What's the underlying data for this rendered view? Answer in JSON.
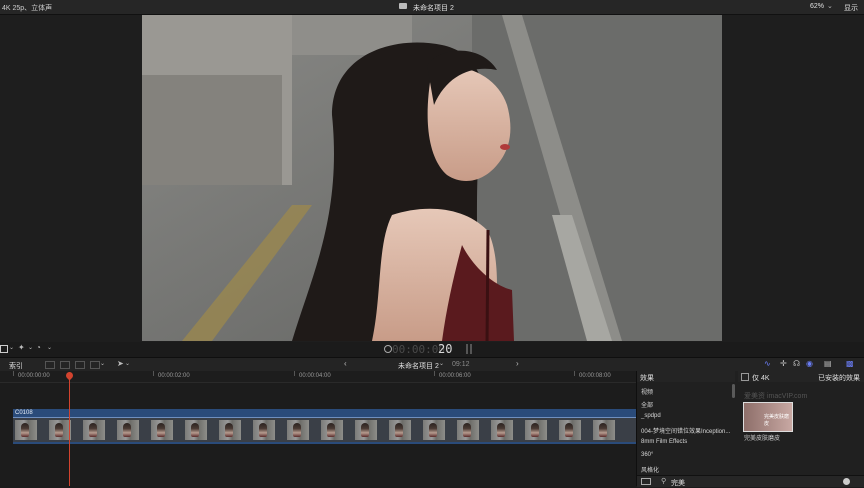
{
  "topbar": {
    "format": "4K 25p、立体声",
    "project_title": "未命名项目 2",
    "zoom": "62%",
    "view_label": "显示"
  },
  "viewer": {
    "timecode_dim": "00:00:00:",
    "timecode_frames": "20"
  },
  "toolbar": {
    "index_label": "索引",
    "project_title": "未命名项目 2",
    "duration": "09:12",
    "only_4k": "仅 4K",
    "installed_effects": "已安装的效果"
  },
  "ruler": {
    "labels": [
      "00:00:00:00",
      "00:00:02:00",
      "00:00:04:00",
      "00:00:06:00",
      "00:00:08:00"
    ]
  },
  "clip": {
    "name": "C0108"
  },
  "effects": {
    "header": "效果",
    "items": [
      "视频",
      "全部",
      "_spdpd",
      "004-梦境空间错位效果Inception...",
      "8mm Film Effects",
      "360°",
      "风格化"
    ],
    "watermark": "爱美资 imacVIP.com",
    "thumb_overlay": "完美皮肤磨皮",
    "thumb_label": "完美皮肤磨皮",
    "search_value": "完美"
  },
  "colors": {
    "accent_blue": "#6a7df5",
    "playhead": "#d2432e",
    "clip_blue": "#2a4b7a"
  }
}
